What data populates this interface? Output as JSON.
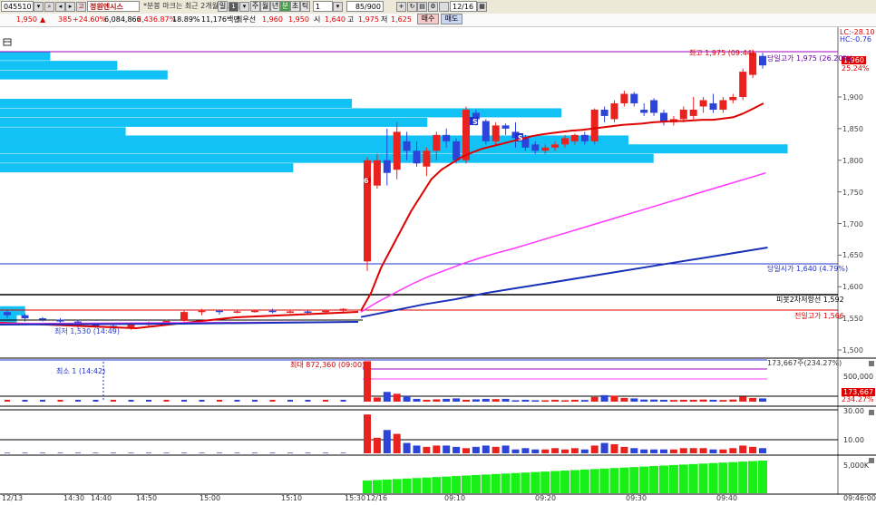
{
  "toolbar": {
    "code": "045510",
    "stock_name": "정원엔시스",
    "notice": "*분봉 마크는 최근 2개월만 조회",
    "periods": [
      "일",
      "주",
      "월",
      "년",
      "분",
      "초",
      "틱"
    ],
    "active_period": "분",
    "interval": "1",
    "count": "85/900",
    "date": "12/16"
  },
  "quote": {
    "price": "1,950",
    "change": "385",
    "change_pct": "+24.60%",
    "volume": "6,084,866",
    "volume_pct": "2,436.87%",
    "turnover": "18.89%",
    "amount": "11,176백만",
    "bid_label": "최우선",
    "ask_price": "1,960",
    "bid_price": "1,950",
    "open_label": "시",
    "open": "1,640",
    "high_label": "고",
    "high": "1,975",
    "low_label": "저",
    "low": "1,625",
    "buy_label": "매수",
    "sell_label": "매도"
  },
  "price_axis": {
    "ticks": [
      "1,900",
      "1,850",
      "1,800",
      "1,750",
      "1,700",
      "1,650",
      "1,600",
      "1,550",
      "1,500"
    ],
    "lc": "LC:-28.10",
    "hc": "HC:-0.76",
    "current": "1,960",
    "current_pct": "25.24%"
  },
  "annotations": {
    "high": "최고 1,975 (09:44)",
    "low": "최저 1,530 (14:49)",
    "today_high": "당일고가 1,975 (26.20%)",
    "today_open": "당일시가 1,640 (4.79%)",
    "pivot2": "피봇2차저항선 1,592",
    "prev_high": "전일고가 1,566",
    "max_volume": "최대 872,360 (09:00)",
    "min_volume": "최소 1 (14:42)",
    "vol_right": "173,667주(234.27%)",
    "vol_axis": "500,000",
    "vol_current": "173,667",
    "vol_current_pct": "234.27%",
    "mark_6": "6",
    "mark_s": "S"
  },
  "osc_axis": {
    "top": "30.00",
    "mid": "10.00"
  },
  "bottom_axis": {
    "label": "5,000K"
  },
  "time_axis": {
    "labels": [
      {
        "t": "12/13"
      },
      {
        "t": "14:30"
      },
      {
        "t": "14:40"
      },
      {
        "t": "14:50"
      },
      {
        "t": "15:00"
      },
      {
        "t": "15:10"
      },
      {
        "t": "15:30"
      },
      {
        "t": "12/16"
      },
      {
        "t": "09:10"
      },
      {
        "t": "09:20"
      },
      {
        "t": "09:30"
      },
      {
        "t": "09:40"
      },
      {
        "t": "09:46:00"
      }
    ]
  },
  "colors": {
    "up": "#e8231f",
    "down": "#2d44d8",
    "profile": "#12c1f5",
    "ma5": "#e00000",
    "ma20": "#ff36ff",
    "ma60": "#1830b8",
    "obv": "#18f018"
  },
  "chart_data": {
    "type": "candlestick",
    "price_ylim": [
      1490,
      2000
    ],
    "price_ticks": [
      1500,
      1550,
      1600,
      1650,
      1700,
      1750,
      1800,
      1850,
      1900
    ],
    "prev_session_candles": [
      {
        "o": 1560,
        "c": 1555,
        "h": 1562,
        "l": 1550,
        "up": false
      },
      {
        "o": 1555,
        "c": 1550,
        "h": 1557,
        "l": 1545,
        "up": false
      },
      {
        "o": 1550,
        "c": 1548,
        "h": 1552,
        "l": 1545,
        "up": false
      },
      {
        "o": 1548,
        "c": 1545,
        "h": 1550,
        "l": 1540,
        "up": false
      },
      {
        "o": 1545,
        "c": 1540,
        "h": 1548,
        "l": 1535,
        "up": false
      },
      {
        "o": 1540,
        "c": 1538,
        "h": 1542,
        "l": 1535,
        "up": false
      },
      {
        "o": 1538,
        "c": 1536,
        "h": 1540,
        "l": 1530,
        "up": false
      },
      {
        "o": 1536,
        "c": 1540,
        "h": 1542,
        "l": 1532,
        "up": true
      },
      {
        "o": 1540,
        "c": 1542,
        "h": 1545,
        "l": 1538,
        "up": true
      },
      {
        "o": 1542,
        "c": 1546,
        "h": 1548,
        "l": 1540,
        "up": true
      },
      {
        "o": 1546,
        "c": 1560,
        "h": 1562,
        "l": 1545,
        "up": true
      },
      {
        "o": 1560,
        "c": 1562,
        "h": 1565,
        "l": 1555,
        "up": true
      },
      {
        "o": 1562,
        "c": 1560,
        "h": 1564,
        "l": 1556,
        "up": false
      },
      {
        "o": 1560,
        "c": 1561,
        "h": 1563,
        "l": 1558,
        "up": true
      },
      {
        "o": 1561,
        "c": 1562,
        "h": 1564,
        "l": 1559,
        "up": true
      },
      {
        "o": 1562,
        "c": 1560,
        "h": 1565,
        "l": 1558,
        "up": false
      },
      {
        "o": 1560,
        "c": 1561,
        "h": 1563,
        "l": 1558,
        "up": true
      },
      {
        "o": 1561,
        "c": 1560,
        "h": 1563,
        "l": 1558,
        "up": false
      },
      {
        "o": 1560,
        "c": 1562,
        "h": 1564,
        "l": 1558,
        "up": true
      },
      {
        "o": 1562,
        "c": 1565,
        "h": 1566,
        "l": 1560,
        "up": true
      }
    ],
    "session_candles": [
      {
        "o": 1640,
        "c": 1800,
        "h": 1805,
        "l": 1625
      },
      {
        "o": 1760,
        "c": 1800,
        "h": 1810,
        "l": 1755
      },
      {
        "o": 1800,
        "c": 1780,
        "h": 1850,
        "l": 1760
      },
      {
        "o": 1785,
        "c": 1845,
        "h": 1860,
        "l": 1770
      },
      {
        "o": 1830,
        "c": 1815,
        "h": 1845,
        "l": 1800
      },
      {
        "o": 1815,
        "c": 1795,
        "h": 1830,
        "l": 1790
      },
      {
        "o": 1790,
        "c": 1815,
        "h": 1820,
        "l": 1775
      },
      {
        "o": 1815,
        "c": 1840,
        "h": 1845,
        "l": 1800
      },
      {
        "o": 1840,
        "c": 1830,
        "h": 1850,
        "l": 1820
      },
      {
        "o": 1830,
        "c": 1800,
        "h": 1835,
        "l": 1795
      },
      {
        "o": 1800,
        "c": 1880,
        "h": 1885,
        "l": 1795
      },
      {
        "o": 1875,
        "c": 1865,
        "h": 1880,
        "l": 1855
      },
      {
        "o": 1862,
        "c": 1830,
        "h": 1865,
        "l": 1825
      },
      {
        "o": 1830,
        "c": 1855,
        "h": 1860,
        "l": 1825
      },
      {
        "o": 1855,
        "c": 1850,
        "h": 1858,
        "l": 1840
      },
      {
        "o": 1845,
        "c": 1835,
        "h": 1860,
        "l": 1820
      },
      {
        "o": 1835,
        "c": 1820,
        "h": 1840,
        "l": 1815
      },
      {
        "o": 1825,
        "c": 1815,
        "h": 1830,
        "l": 1810
      },
      {
        "o": 1815,
        "c": 1820,
        "h": 1825,
        "l": 1810
      },
      {
        "o": 1820,
        "c": 1825,
        "h": 1830,
        "l": 1815
      },
      {
        "o": 1825,
        "c": 1835,
        "h": 1840,
        "l": 1820
      },
      {
        "o": 1830,
        "c": 1840,
        "h": 1842,
        "l": 1825
      },
      {
        "o": 1840,
        "c": 1830,
        "h": 1845,
        "l": 1825
      },
      {
        "o": 1830,
        "c": 1880,
        "h": 1882,
        "l": 1825
      },
      {
        "o": 1880,
        "c": 1870,
        "h": 1885,
        "l": 1860
      },
      {
        "o": 1865,
        "c": 1890,
        "h": 1895,
        "l": 1860
      },
      {
        "o": 1890,
        "c": 1905,
        "h": 1910,
        "l": 1885
      },
      {
        "o": 1905,
        "c": 1890,
        "h": 1908,
        "l": 1885
      },
      {
        "o": 1880,
        "c": 1875,
        "h": 1890,
        "l": 1870
      },
      {
        "o": 1895,
        "c": 1875,
        "h": 1898,
        "l": 1870
      },
      {
        "o": 1875,
        "c": 1860,
        "h": 1880,
        "l": 1855
      },
      {
        "o": 1860,
        "c": 1865,
        "h": 1870,
        "l": 1855
      },
      {
        "o": 1865,
        "c": 1880,
        "h": 1885,
        "l": 1860
      },
      {
        "o": 1870,
        "c": 1880,
        "h": 1900,
        "l": 1865
      },
      {
        "o": 1885,
        "c": 1895,
        "h": 1900,
        "l": 1875
      },
      {
        "o": 1890,
        "c": 1880,
        "h": 1905,
        "l": 1875
      },
      {
        "o": 1880,
        "c": 1895,
        "h": 1900,
        "l": 1875
      },
      {
        "o": 1895,
        "c": 1900,
        "h": 1905,
        "l": 1890
      },
      {
        "o": 1900,
        "c": 1940,
        "h": 1945,
        "l": 1895
      },
      {
        "o": 1935,
        "c": 1970,
        "h": 1975,
        "l": 1930
      },
      {
        "o": 1965,
        "c": 1950,
        "h": 1970,
        "l": 1945
      }
    ],
    "volume_profile": [
      {
        "price": 1965,
        "len": 0.06
      },
      {
        "price": 1950,
        "len": 0.14
      },
      {
        "price": 1935,
        "len": 0.2
      },
      {
        "price": 1890,
        "len": 0.42
      },
      {
        "price": 1875,
        "len": 0.67
      },
      {
        "price": 1860,
        "len": 0.51
      },
      {
        "price": 1845,
        "len": 0.15
      },
      {
        "price": 1832,
        "len": 0.75
      },
      {
        "price": 1818,
        "len": 0.94
      },
      {
        "price": 1803,
        "len": 0.78
      },
      {
        "price": 1788,
        "len": 0.35
      },
      {
        "price": 1562,
        "len": 0.03
      },
      {
        "price": 1548,
        "len": 0.02
      }
    ],
    "ma5_session": [
      1562,
      1590,
      1630,
      1660,
      1690,
      1720,
      1745,
      1770,
      1785,
      1795,
      1805,
      1812,
      1818,
      1822,
      1826,
      1830,
      1834,
      1838,
      1841,
      1843,
      1845,
      1847,
      1848,
      1850,
      1852,
      1854,
      1856,
      1857,
      1858,
      1860,
      1861,
      1862,
      1862,
      1863,
      1864,
      1864,
      1866,
      1868,
      1874,
      1882,
      1890
    ],
    "ma20_session": [
      1560,
      1576,
      1590,
      1604,
      1616,
      1626,
      1636,
      1645,
      1653,
      1660,
      1668,
      1676,
      1684,
      1692,
      1700,
      1708,
      1716,
      1724,
      1732,
      1740,
      1748,
      1756,
      1764,
      1772,
      1780
    ],
    "ma60_session": [
      1552,
      1562,
      1572,
      1580,
      1590,
      1598,
      1606,
      1614,
      1622,
      1630,
      1638,
      1646,
      1654,
      1662
    ],
    "volume_session": [
      872360,
      90000,
      210000,
      170000,
      120000,
      60000,
      40000,
      50000,
      60000,
      70000,
      40000,
      50000,
      60000,
      55000,
      60000,
      30000,
      40000,
      30000,
      30000,
      40000,
      30000,
      40000,
      35000,
      100000,
      140000,
      130000,
      80000,
      70000,
      45000,
      45000,
      40000,
      35000,
      40000,
      40000,
      45000,
      40000,
      35000,
      45000,
      110000,
      80000,
      70000
    ],
    "volume_ylim": [
      0,
      900000
    ],
    "osc_session": [
      30,
      12,
      18,
      15,
      8,
      6,
      5,
      6,
      6,
      5,
      4,
      5,
      6,
      5,
      6,
      3,
      4,
      3,
      3,
      4,
      3,
      4,
      3,
      6,
      8,
      7,
      5,
      4,
      3,
      3,
      3,
      3,
      4,
      4,
      4,
      3,
      3,
      4,
      6,
      5,
      4
    ],
    "osc_ylim": [
      0,
      35
    ],
    "obv_ylim": [
      0,
      60000
    ]
  }
}
